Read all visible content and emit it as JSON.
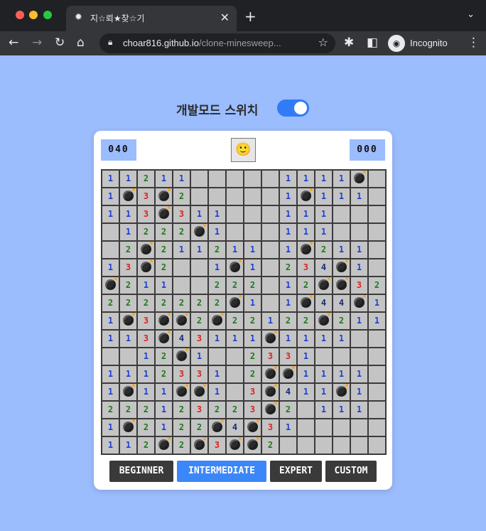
{
  "browser": {
    "tab_title": "지☆뢰★찾☆기",
    "tab_favicon": "✹",
    "url_host": "choar816.github.io",
    "url_path": "/clone-minesweep...",
    "incognito_label": "Incognito"
  },
  "dev_mode": {
    "label": "개발모드 스위치",
    "enabled": true
  },
  "game": {
    "mines_left": "040",
    "timer": "000",
    "face": "🙂",
    "number_colors": {
      "1": "#1a3fd6",
      "2": "#1e7a1e",
      "3": "#e02020",
      "4": "#1a2a7a"
    },
    "board": [
      [
        "1",
        "1",
        "2",
        "1",
        "1",
        "",
        "",
        "",
        "",
        "",
        "1",
        "1",
        "1",
        "1",
        "*",
        ""
      ],
      [
        "1",
        "*",
        "3",
        "*",
        "2",
        "",
        "",
        "",
        "",
        "",
        "1",
        "*",
        "1",
        "1",
        "1",
        ""
      ],
      [
        "1",
        "1",
        "3",
        "*",
        "3",
        "1",
        "1",
        "",
        "",
        "",
        "1",
        "1",
        "1",
        "",
        ""
      ],
      [
        "",
        "1",
        "2",
        "2",
        "2",
        "*",
        "1",
        "",
        "",
        "",
        "1",
        "1",
        "1",
        "",
        ""
      ],
      [
        "",
        "2",
        "*",
        "2",
        "1",
        "1",
        "2",
        "1",
        "1",
        "",
        "1",
        "*",
        "2",
        "1",
        "1",
        ""
      ],
      [
        "1",
        "3",
        "*",
        "2",
        "",
        "",
        "1",
        "*",
        "1",
        "",
        "2",
        "3",
        "4",
        "*",
        "1",
        ""
      ],
      [
        "*",
        "2",
        "1",
        "1",
        "",
        "",
        "2",
        "2",
        "2",
        "",
        "1",
        "2",
        "*",
        "*",
        "3",
        "2"
      ],
      [
        "2",
        "2",
        "2",
        "2",
        "2",
        "2",
        "2",
        "*",
        "1",
        "",
        "1",
        "*",
        "4",
        "4",
        "*",
        "1"
      ],
      [
        "1",
        "*",
        "3",
        "*",
        "*",
        "2",
        "*",
        "2",
        "2",
        "1",
        "2",
        "2",
        "*",
        "2",
        "1",
        "1"
      ],
      [
        "1",
        "1",
        "3",
        "*",
        "4",
        "3",
        "1",
        "1",
        "1",
        "*",
        "1",
        "1",
        "1",
        "1",
        "",
        ""
      ],
      [
        "",
        "",
        "1",
        "2",
        "*",
        "1",
        "",
        "",
        "2",
        "3",
        "3",
        "1",
        "",
        "",
        "",
        ""
      ],
      [
        "1",
        "1",
        "1",
        "2",
        "3",
        "3",
        "1",
        "",
        "2",
        "*",
        "*",
        "1",
        "1",
        "1",
        "1",
        ""
      ],
      [
        "1",
        "*",
        "1",
        "1",
        "*",
        "*",
        "1",
        "",
        "3",
        "*",
        "4",
        "1",
        "1",
        "*",
        "1",
        ""
      ],
      [
        "2",
        "2",
        "2",
        "1",
        "2",
        "3",
        "2",
        "2",
        "3",
        "*",
        "2",
        "",
        "1",
        "1",
        "1",
        ""
      ],
      [
        "1",
        "*",
        "2",
        "1",
        "2",
        "2",
        "*",
        "4",
        "*",
        "3",
        "1",
        "",
        "",
        "",
        "",
        ""
      ],
      [
        "1",
        "1",
        "2",
        "*",
        "2",
        "*",
        "3",
        "*",
        "*",
        "2",
        "",
        "",
        "",
        "",
        "",
        ""
      ]
    ]
  },
  "modes": [
    {
      "label": "BEGINNER",
      "active": false
    },
    {
      "label": "INTERMEDIATE",
      "active": true
    },
    {
      "label": "EXPERT",
      "active": false
    },
    {
      "label": "CUSTOM",
      "active": false
    }
  ]
}
